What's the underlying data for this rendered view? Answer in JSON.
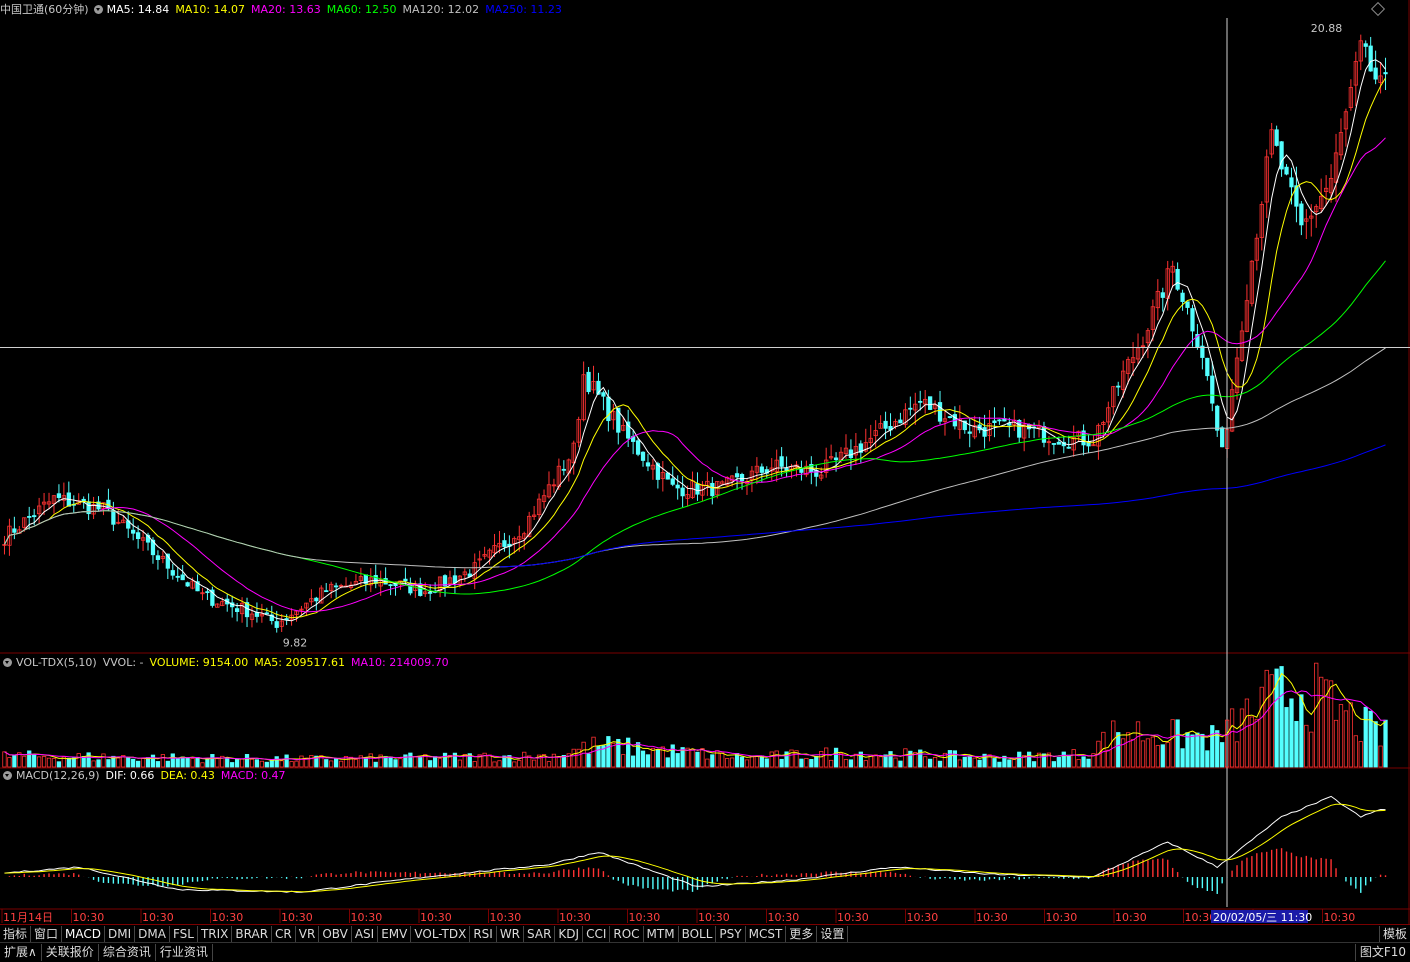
{
  "main_legend": {
    "stock": "中国卫通(60分钟)",
    "ma5": "MA5: 14.84",
    "ma10": "MA10: 14.07",
    "ma20": "MA20: 13.63",
    "ma60": "MA60: 12.50",
    "ma120": "MA120: 12.02",
    "ma250": "MA250: 11.23"
  },
  "vol_legend": {
    "name": "VOL-TDX(5,10)",
    "vvol": "VVOL: -",
    "volume": "VOLUME: 9154.00",
    "ma5": "MA5: 209517.61",
    "ma10": "MA10: 214009.70"
  },
  "macd_legend": {
    "name": "MACD(12,26,9)",
    "dif": "DIF: 0.66",
    "dea": "DEA: 0.43",
    "macd": "MACD: 0.47"
  },
  "colors": {
    "up": "#ff3232",
    "down": "#54ffff",
    "ma5": "#ffffff",
    "ma10": "#ffff00",
    "ma20": "#ff00ff",
    "ma60": "#00ff00",
    "ma120": "#c0c0c0",
    "ma250": "#0000ff",
    "grid": "#7a0000"
  },
  "chart_data": {
    "type": "candlestick",
    "title": "中国卫通(60分钟)",
    "high_label": "20.88",
    "low_label": "9.82",
    "crosshair_price": "15.10",
    "cursor_time": "20/02/05/三 11:30",
    "x_labels": [
      "11月14日",
      "10:30",
      "10:30",
      "10:30",
      "10:30",
      "10:30",
      "10:30",
      "10:30",
      "10:30",
      "10:30",
      "10:30",
      "10:30",
      "10:30",
      "10:30",
      "10:30",
      "10:30",
      "10:30",
      "10:30",
      "10:30",
      "10:30"
    ],
    "price_range": [
      9.5,
      21.2
    ],
    "price_anchors": [
      [
        0,
        11.6
      ],
      [
        10,
        12.3
      ],
      [
        20,
        12.1
      ],
      [
        30,
        11.3
      ],
      [
        40,
        10.5
      ],
      [
        50,
        10.2
      ],
      [
        55,
        10.0
      ],
      [
        65,
        10.6
      ],
      [
        75,
        10.8
      ],
      [
        85,
        10.6
      ],
      [
        95,
        11.0
      ],
      [
        105,
        11.8
      ],
      [
        115,
        13.2
      ],
      [
        117,
        14.6
      ],
      [
        125,
        13.5
      ],
      [
        135,
        12.5
      ],
      [
        145,
        12.5
      ],
      [
        155,
        12.9
      ],
      [
        165,
        12.8
      ],
      [
        175,
        13.4
      ],
      [
        185,
        14.1
      ],
      [
        195,
        13.6
      ],
      [
        205,
        13.6
      ],
      [
        215,
        13.4
      ],
      [
        220,
        13.4
      ],
      [
        226,
        14.6
      ],
      [
        230,
        15.3
      ],
      [
        236,
        16.6
      ],
      [
        242,
        15.0
      ],
      [
        246,
        13.1
      ],
      [
        250,
        15.6
      ],
      [
        256,
        19.0
      ],
      [
        262,
        17.3
      ],
      [
        268,
        18.2
      ],
      [
        274,
        20.6
      ],
      [
        278,
        19.9
      ]
    ],
    "volume_range": [
      0,
      600000
    ],
    "volume_anchors": [
      [
        0,
        70000
      ],
      [
        30,
        60000
      ],
      [
        60,
        50000
      ],
      [
        110,
        70000
      ],
      [
        120,
        140000
      ],
      [
        150,
        60000
      ],
      [
        170,
        90000
      ],
      [
        200,
        60000
      ],
      [
        218,
        80000
      ],
      [
        225,
        230000
      ],
      [
        245,
        180000
      ],
      [
        255,
        420000
      ],
      [
        262,
        500000
      ],
      [
        268,
        380000
      ],
      [
        278,
        200000
      ]
    ],
    "macd_range": [
      -0.6,
      1.9
    ],
    "dif_anchors": [
      [
        0,
        0.08
      ],
      [
        15,
        0.2
      ],
      [
        35,
        -0.25
      ],
      [
        60,
        -0.3
      ],
      [
        85,
        0.0
      ],
      [
        110,
        0.25
      ],
      [
        120,
        0.5
      ],
      [
        140,
        -0.2
      ],
      [
        160,
        -0.05
      ],
      [
        180,
        0.2
      ],
      [
        200,
        0.05
      ],
      [
        220,
        0.0
      ],
      [
        235,
        0.7
      ],
      [
        245,
        0.2
      ],
      [
        258,
        1.2
      ],
      [
        268,
        1.6
      ],
      [
        274,
        1.2
      ],
      [
        278,
        1.35
      ]
    ],
    "series": [
      {
        "name": "MA5"
      },
      {
        "name": "MA10"
      },
      {
        "name": "MA20"
      },
      {
        "name": "MA60"
      },
      {
        "name": "MA120"
      },
      {
        "name": "MA250"
      }
    ]
  },
  "tabs": [
    "指标",
    "窗口",
    "MACD",
    "DMI",
    "DMA",
    "FSL",
    "TRIX",
    "BRAR",
    "CR",
    "VR",
    "OBV",
    "ASI",
    "EMV",
    "VOL-TDX",
    "RSI",
    "WR",
    "SAR",
    "KDJ",
    "CCI",
    "ROC",
    "MTM",
    "BOLL",
    "PSY",
    "MCST",
    "更多",
    "设置"
  ],
  "tabs_right": "模板",
  "status": [
    "扩展∧",
    "关联报价",
    "综合资讯",
    "行业资讯"
  ],
  "status_right": "图文F10"
}
